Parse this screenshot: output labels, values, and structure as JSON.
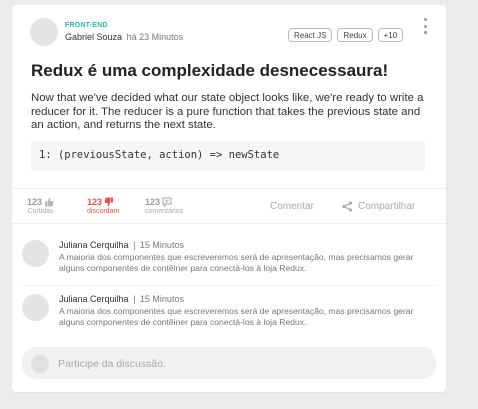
{
  "post": {
    "category": "FRONT-END",
    "author": "Gabriel Souza",
    "time": "há 23 Minutos",
    "tags": [
      "React JS",
      "Redux",
      "+10"
    ],
    "title": "Redux é uma complexidade desnecessaura!",
    "body": "Now that we've decided what our state object looks like, we're ready to write a reducer for it. The reducer is a pure function that takes the previous state and an action, and returns the next state.",
    "code": "1: (previousState, action) => newState"
  },
  "stats": {
    "likes": {
      "count": "123",
      "label": "Curtidas"
    },
    "dislikes": {
      "count": "123",
      "label": "discordam"
    },
    "comments": {
      "count": "123",
      "label": "comentários"
    }
  },
  "actions": {
    "comment": "Comentar",
    "share": "Compartilhar"
  },
  "comments": [
    {
      "author": "Juliana Cerquilha",
      "separator": "|",
      "time": "15 Minutos",
      "text": "A maioria dos componentes que escreveremos será de apresentação, mas precisamos gerar alguns componentes de contêiner para conectá-los à loja Redux."
    },
    {
      "author": "Juliana Cerquilha",
      "separator": "|",
      "time": "15 Minutos",
      "text": "A maioria dos componentes que escreveremos será de apresentação, mas precisamos gerar alguns componentes de contêiner para conectá-los à loja Redux."
    }
  ],
  "discussion": {
    "placeholder": "Participe da discussão."
  },
  "colors": {
    "accent": "#2eb89a",
    "dislike": "#e25353",
    "background": "#ececec"
  }
}
